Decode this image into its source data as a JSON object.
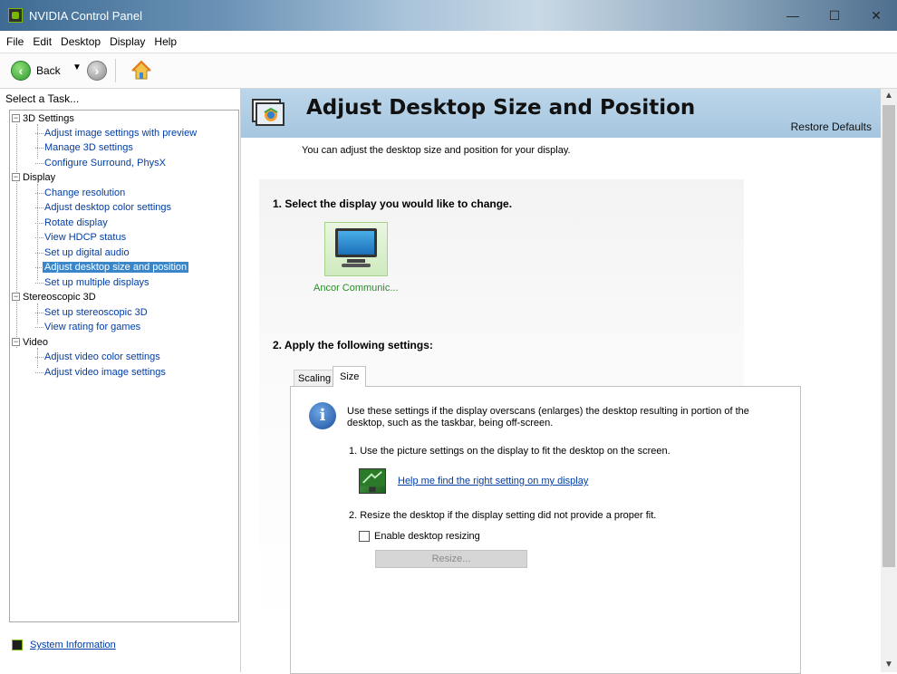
{
  "window": {
    "title": "NVIDIA Control Panel",
    "minimize": "—",
    "maximize": "☐",
    "close": "✕"
  },
  "menu": [
    "File",
    "Edit",
    "Desktop",
    "Display",
    "Help"
  ],
  "toolbar": {
    "back_label": "Back",
    "dropdown_glyph": "▼"
  },
  "sidebar": {
    "header": "Select a Task...",
    "categories": [
      {
        "label": "3D Settings",
        "items": [
          "Adjust image settings with preview",
          "Manage 3D settings",
          "Configure Surround, PhysX"
        ]
      },
      {
        "label": "Display",
        "items": [
          "Change resolution",
          "Adjust desktop color settings",
          "Rotate display",
          "View HDCP status",
          "Set up digital audio",
          "Adjust desktop size and position",
          "Set up multiple displays"
        ]
      },
      {
        "label": "Stereoscopic 3D",
        "items": [
          "Set up stereoscopic 3D",
          "View rating for games"
        ]
      },
      {
        "label": "Video",
        "items": [
          "Adjust video color settings",
          "Adjust video image settings"
        ]
      }
    ],
    "selected_item": "Adjust desktop size and position",
    "system_info": "System Information"
  },
  "main": {
    "title": "Adjust Desktop Size and Position",
    "restore_defaults": "Restore Defaults",
    "description": "You can adjust the desktop size and position for your display.",
    "section1": "1. Select the display you would like to change.",
    "display_name": "Ancor Communic...",
    "section2": "2. Apply the following settings:",
    "tabs": [
      "Scaling",
      "Size"
    ],
    "active_tab": "Size",
    "size_tab": {
      "info_line1": "Use these settings if the display overscans (enlarges) the desktop resulting in portion of the",
      "info_line2": "desktop, such as the taskbar, being off-screen.",
      "step1": "1. Use the picture settings on the display to fit the desktop on the screen.",
      "help_link": "Help me find the right setting on my display",
      "step2": "2. Resize the desktop if the display setting did not provide a proper fit.",
      "enable_resizing_label": "Enable desktop resizing",
      "enable_resizing_checked": false,
      "resize_button": "Resize..."
    }
  },
  "colors": {
    "nvidia_green": "#76b900",
    "link_blue": "#003da6",
    "header_blue": "#a6c6df",
    "selection": "#3a86c8"
  }
}
